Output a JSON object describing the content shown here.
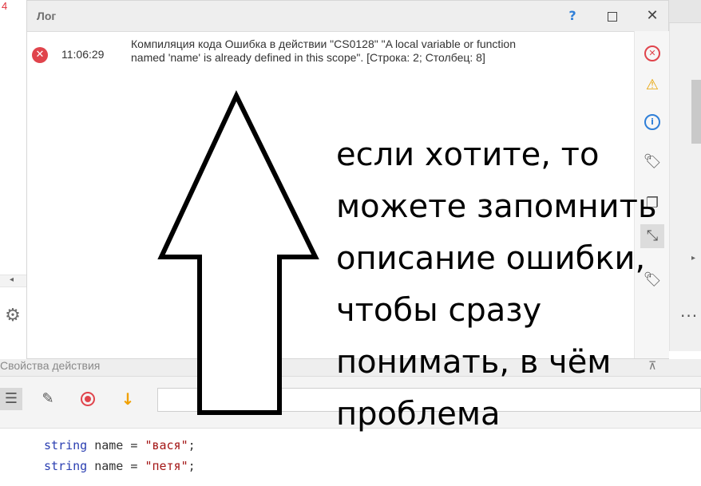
{
  "log_panel": {
    "title": "Лог",
    "help_label": "?",
    "close_label": "✕",
    "entries": [
      {
        "level": "error",
        "time": "11:06:29",
        "message_line1": "Компиляция кода  Ошибка в действии \"CS0128\" \"A local variable or function",
        "message_line2": "named 'name' is already defined in this scope\". [Строка: 2; Столбец: 8]"
      }
    ],
    "filter_icons": [
      "error-filter-icon",
      "warning-filter-icon",
      "info-filter-icon",
      "tag-icon",
      "copy-icon",
      "expand-icon",
      "tag-icon"
    ]
  },
  "background": {
    "left_mark": "4"
  },
  "properties": {
    "title": "Свойства действия",
    "pin_label": "⊼",
    "input_value": ""
  },
  "code": {
    "lines": [
      {
        "keyword": "string",
        "identifier": " name = ",
        "literal": "\"вася\"",
        "end": ";"
      },
      {
        "keyword": "string",
        "identifier": " name = ",
        "literal": "\"петя\"",
        "end": ";"
      }
    ]
  },
  "annotation": {
    "lines": [
      "если хотите, то",
      "можете запомнить",
      "описание ошибки,",
      "чтобы сразу",
      "понимать, в чём",
      "проблема"
    ]
  },
  "colors": {
    "error": "#e0444c",
    "warning": "#e8a200",
    "info": "#2f7fd8",
    "keyword": "#2a3eb1",
    "string": "#a31515"
  }
}
